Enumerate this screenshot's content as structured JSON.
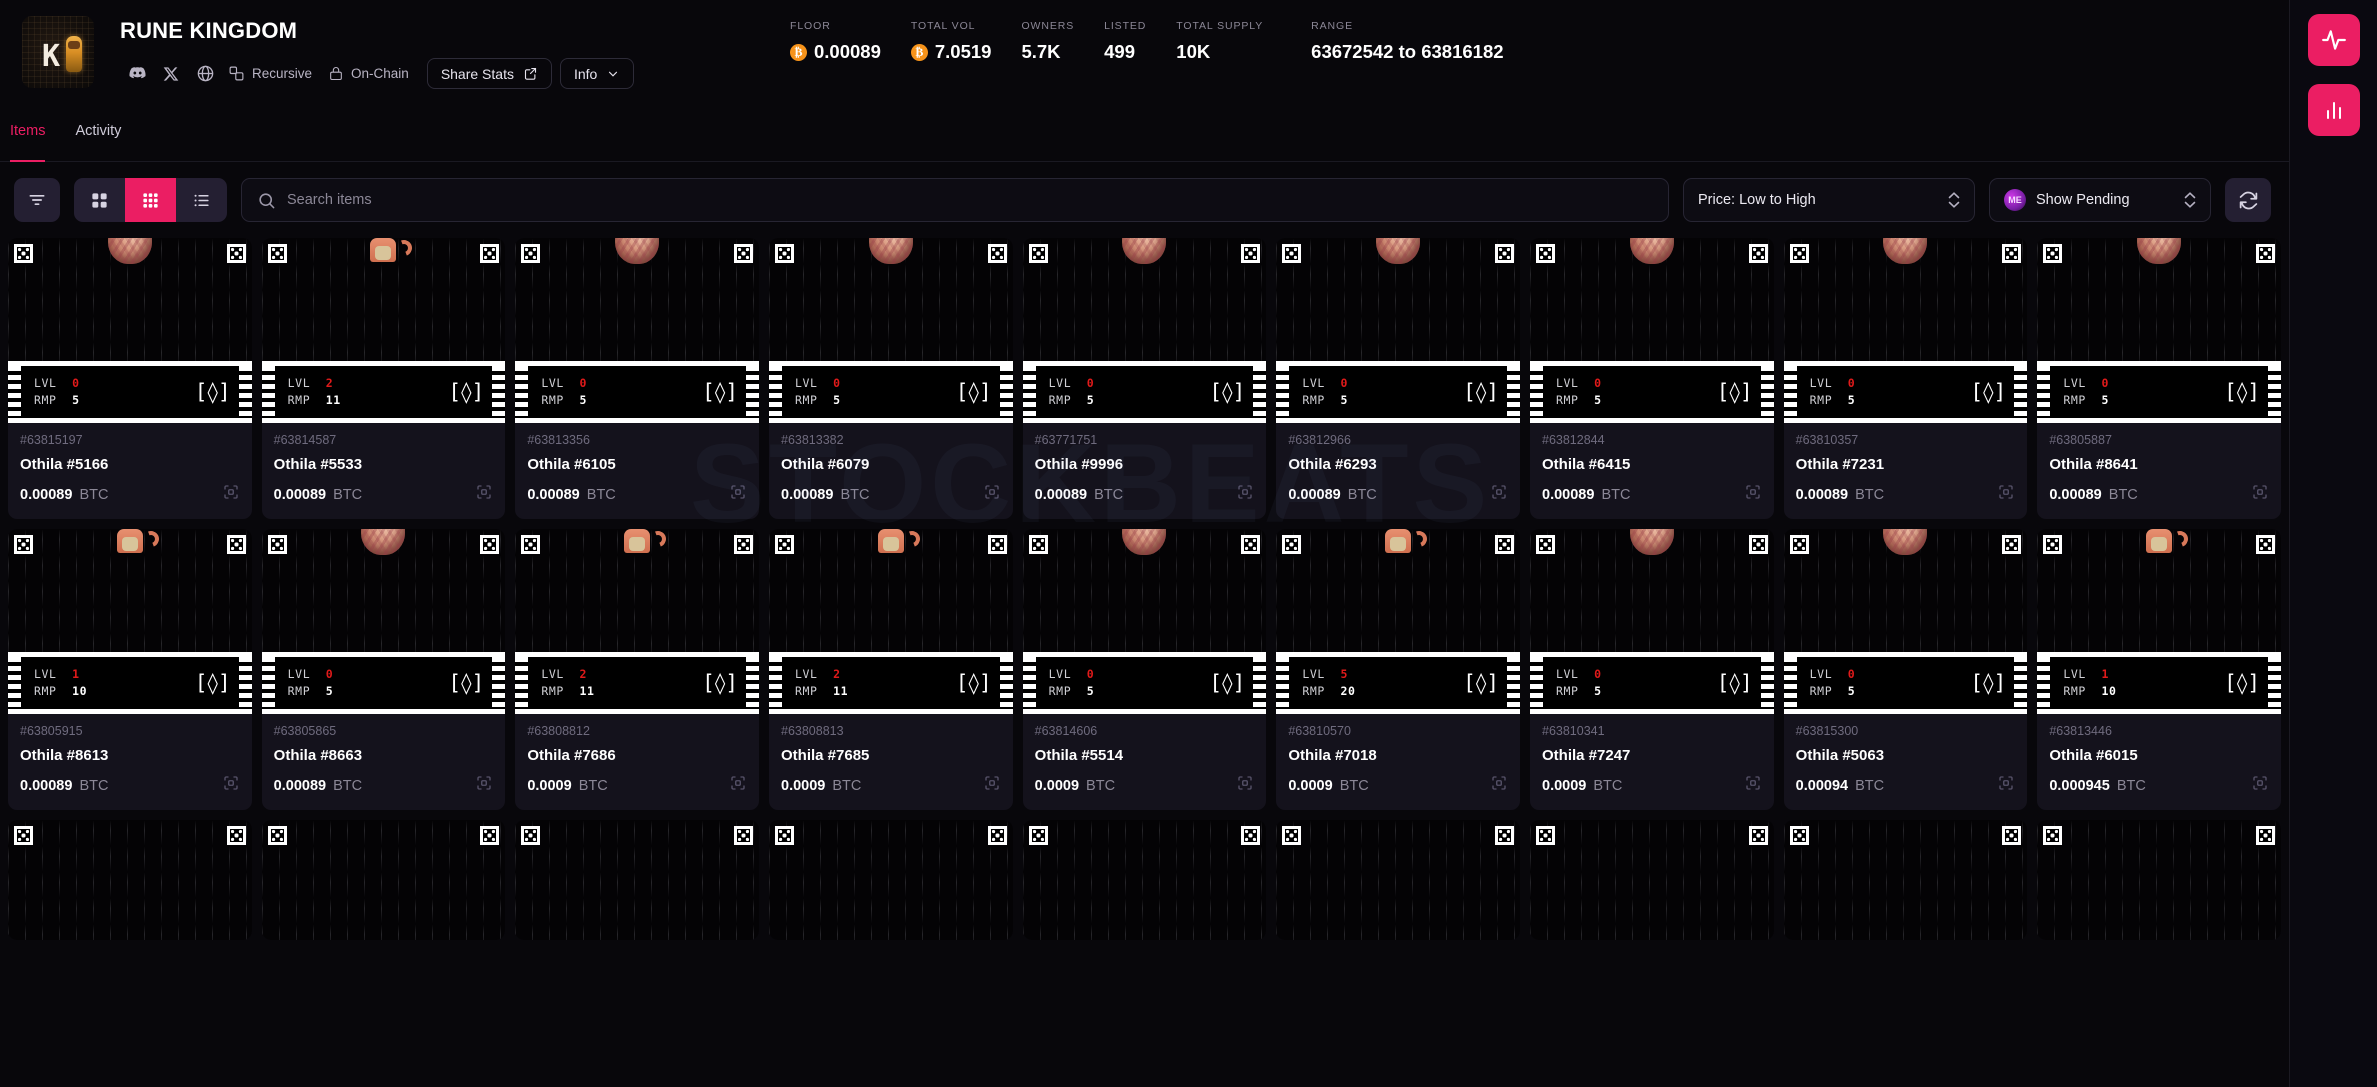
{
  "header": {
    "logo_icon": "rune-kingdom-logo",
    "title": "RUNE KINGDOM",
    "social_icons": [
      {
        "name": "discord-icon",
        "glyph": "discord"
      },
      {
        "name": "x-twitter-icon",
        "glyph": "x"
      },
      {
        "name": "website-globe-icon",
        "glyph": "globe"
      }
    ],
    "badges": [
      {
        "name": "recursive-badge",
        "label": "Recursive",
        "icon": "recursive-icon"
      },
      {
        "name": "on-chain-badge",
        "label": "On-Chain",
        "icon": "lock-icon"
      }
    ],
    "share_stats_label": "Share Stats",
    "share_icon": "share-external-icon",
    "info_label": "Info",
    "info_icon": "chevron-down-icon"
  },
  "stats": [
    {
      "label": "FLOOR",
      "value": "0.00089",
      "btc": true
    },
    {
      "label": "TOTAL VOL",
      "value": "7.0519",
      "btc": true
    },
    {
      "label": "OWNERS",
      "value": "5.7K",
      "btc": false
    },
    {
      "label": "LISTED",
      "value": "499",
      "btc": false
    },
    {
      "label": "TOTAL SUPPLY",
      "value": "10K",
      "btc": false
    },
    {
      "label": "RANGE",
      "value": "63672542 to 63816182",
      "btc": false
    }
  ],
  "tabs": [
    {
      "label": "Items",
      "active": true
    },
    {
      "label": "Activity",
      "active": false
    }
  ],
  "toolbar": {
    "filter_icon": "filter-icon",
    "views": [
      {
        "name": "grid-large-view",
        "icon": "grid-4-icon",
        "active": false
      },
      {
        "name": "grid-small-view",
        "icon": "grid-9-icon",
        "active": true
      },
      {
        "name": "list-view",
        "icon": "list-icon",
        "active": false
      }
    ],
    "search_placeholder": "Search items",
    "search_value": "",
    "search_icon": "search-icon",
    "sort_value": "Price: Low to High",
    "pending_value": "Show Pending",
    "pending_logo": "magic-eden-icon",
    "refresh_icon": "refresh-icon"
  },
  "right_rail": [
    {
      "name": "activity-pulse-button",
      "icon": "pulse-icon"
    },
    {
      "name": "chart-bars-button",
      "icon": "bar-chart-icon"
    }
  ],
  "watermark": "STOCKBEATS",
  "colors": {
    "accent": "#eb1e63",
    "bitcoin": "#f7931a",
    "level": "#e01a1a",
    "card_bg": "#14121c",
    "page_bg": "#08070b"
  },
  "labels": {
    "lvl": "LVL",
    "rmp": "RMP",
    "currency": "BTC",
    "rune_glyph": "[◊]",
    "cart_icon": "add-to-cart-icon"
  },
  "items": [
    {
      "id": "#63815197",
      "name": "Othila #5166",
      "price": "0.00089",
      "lvl": "0",
      "rmp": "5",
      "art": "egg"
    },
    {
      "id": "#63814587",
      "name": "Othila #5533",
      "price": "0.00089",
      "lvl": "2",
      "rmp": "11",
      "art": "mon"
    },
    {
      "id": "#63813356",
      "name": "Othila #6105",
      "price": "0.00089",
      "lvl": "0",
      "rmp": "5",
      "art": "egg"
    },
    {
      "id": "#63813382",
      "name": "Othila #6079",
      "price": "0.00089",
      "lvl": "0",
      "rmp": "5",
      "art": "egg"
    },
    {
      "id": "#63771751",
      "name": "Othila #9996",
      "price": "0.00089",
      "lvl": "0",
      "rmp": "5",
      "art": "egg"
    },
    {
      "id": "#63812966",
      "name": "Othila #6293",
      "price": "0.00089",
      "lvl": "0",
      "rmp": "5",
      "art": "egg"
    },
    {
      "id": "#63812844",
      "name": "Othila #6415",
      "price": "0.00089",
      "lvl": "0",
      "rmp": "5",
      "art": "egg"
    },
    {
      "id": "#63810357",
      "name": "Othila #7231",
      "price": "0.00089",
      "lvl": "0",
      "rmp": "5",
      "art": "egg"
    },
    {
      "id": "#63805887",
      "name": "Othila #8641",
      "price": "0.00089",
      "lvl": "0",
      "rmp": "5",
      "art": "egg"
    },
    {
      "id": "#63805915",
      "name": "Othila #8613",
      "price": "0.00089",
      "lvl": "1",
      "rmp": "10",
      "art": "mon"
    },
    {
      "id": "#63805865",
      "name": "Othila #8663",
      "price": "0.00089",
      "lvl": "0",
      "rmp": "5",
      "art": "egg"
    },
    {
      "id": "#63808812",
      "name": "Othila #7686",
      "price": "0.0009",
      "lvl": "2",
      "rmp": "11",
      "art": "mon"
    },
    {
      "id": "#63808813",
      "name": "Othila #7685",
      "price": "0.0009",
      "lvl": "2",
      "rmp": "11",
      "art": "mon"
    },
    {
      "id": "#63814606",
      "name": "Othila #5514",
      "price": "0.0009",
      "lvl": "0",
      "rmp": "5",
      "art": "egg"
    },
    {
      "id": "#63810570",
      "name": "Othila #7018",
      "price": "0.0009",
      "lvl": "5",
      "rmp": "20",
      "art": "mon"
    },
    {
      "id": "#63810341",
      "name": "Othila #7247",
      "price": "0.0009",
      "lvl": "0",
      "rmp": "5",
      "art": "egg"
    },
    {
      "id": "#63815300",
      "name": "Othila #5063",
      "price": "0.00094",
      "lvl": "0",
      "rmp": "5",
      "art": "egg"
    },
    {
      "id": "#63813446",
      "name": "Othila #6015",
      "price": "0.000945",
      "lvl": "1",
      "rmp": "10",
      "art": "mon"
    }
  ],
  "partial_row": [
    {
      "art": "none"
    },
    {
      "art": "none"
    },
    {
      "art": "none"
    },
    {
      "art": "none"
    },
    {
      "art": "none"
    },
    {
      "art": "none"
    },
    {
      "art": "none"
    },
    {
      "art": "none"
    },
    {
      "art": "none"
    }
  ]
}
